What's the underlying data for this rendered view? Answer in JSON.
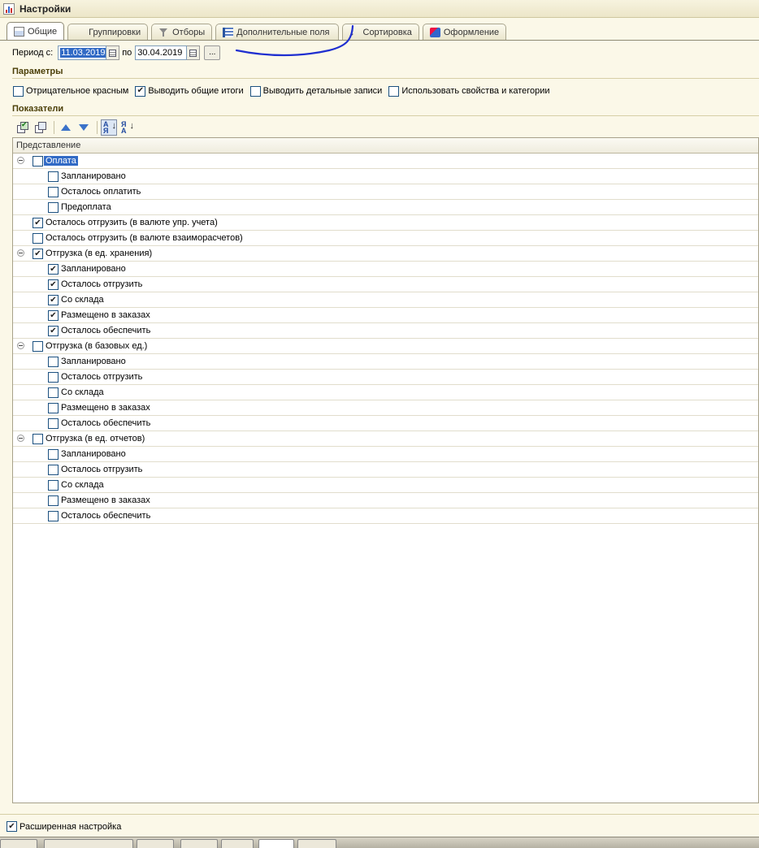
{
  "window": {
    "title": "Настройки"
  },
  "tabs": [
    {
      "label": "Общие",
      "icon": "general-icon",
      "active": true
    },
    {
      "label": "Группировки",
      "icon": "grid-icon",
      "active": false
    },
    {
      "label": "Отборы",
      "icon": "filter-icon",
      "active": false
    },
    {
      "label": "Дополнительные поля",
      "icon": "fields-icon",
      "active": false
    },
    {
      "label": "Сортировка",
      "icon": "sort-icon",
      "active": false
    },
    {
      "label": "Оформление",
      "icon": "design-icon",
      "active": false
    }
  ],
  "period": {
    "from_label": "Период с:",
    "from_value": "11.03.2019",
    "to_label": "по",
    "to_value": "30.04.2019",
    "dots_label": "..."
  },
  "parameters": {
    "title": "Параметры",
    "items": [
      {
        "label": "Отрицательное красным",
        "checked": false
      },
      {
        "label": "Выводить общие итоги",
        "checked": true
      },
      {
        "label": "Выводить детальные записи",
        "checked": false
      },
      {
        "label": "Использовать свойства и категории",
        "checked": false
      }
    ]
  },
  "indicators": {
    "title": "Показатели",
    "column_header": "Представление",
    "rows": [
      {
        "label": "Оплата",
        "level": 0,
        "checked": false,
        "expandable": true,
        "selected": true
      },
      {
        "label": "Запланировано",
        "level": 1,
        "checked": false
      },
      {
        "label": "Осталось оплатить",
        "level": 1,
        "checked": false
      },
      {
        "label": "Предоплата",
        "level": 1,
        "checked": false
      },
      {
        "label": "Осталось отгрузить  (в валюте упр. учета)",
        "level": 0,
        "checked": true
      },
      {
        "label": "Осталось отгрузить  (в валюте взаиморасчетов)",
        "level": 0,
        "checked": false
      },
      {
        "label": "Отгрузка (в ед. хранения)",
        "level": 0,
        "checked": true,
        "expandable": true
      },
      {
        "label": "Запланировано",
        "level": 1,
        "checked": true
      },
      {
        "label": "Осталось отгрузить",
        "level": 1,
        "checked": true
      },
      {
        "label": "Со склада",
        "level": 1,
        "checked": true
      },
      {
        "label": "Размещено в заказах",
        "level": 1,
        "checked": true
      },
      {
        "label": "Осталось обеспечить",
        "level": 1,
        "checked": true
      },
      {
        "label": "Отгрузка (в базовых ед.)",
        "level": 0,
        "checked": false,
        "expandable": true
      },
      {
        "label": "Запланировано",
        "level": 1,
        "checked": false
      },
      {
        "label": "Осталось отгрузить",
        "level": 1,
        "checked": false
      },
      {
        "label": "Со склада",
        "level": 1,
        "checked": false
      },
      {
        "label": "Размещено в заказах",
        "level": 1,
        "checked": false
      },
      {
        "label": "Осталось обеспечить",
        "level": 1,
        "checked": false
      },
      {
        "label": "Отгрузка (в ед. отчетов)",
        "level": 0,
        "checked": false,
        "expandable": true
      },
      {
        "label": "Запланировано",
        "level": 1,
        "checked": false
      },
      {
        "label": "Осталось отгрузить",
        "level": 1,
        "checked": false
      },
      {
        "label": "Со склада",
        "level": 1,
        "checked": false
      },
      {
        "label": "Размещено в заказах",
        "level": 1,
        "checked": false
      },
      {
        "label": "Осталось обеспечить",
        "level": 1,
        "checked": false
      }
    ]
  },
  "footer": {
    "extended_label": "Расширенная настройка",
    "extended_checked": true
  },
  "colors": {
    "selection": "#316ac5",
    "section_title": "#4b3f08",
    "annotation": "#1f2fd0"
  }
}
